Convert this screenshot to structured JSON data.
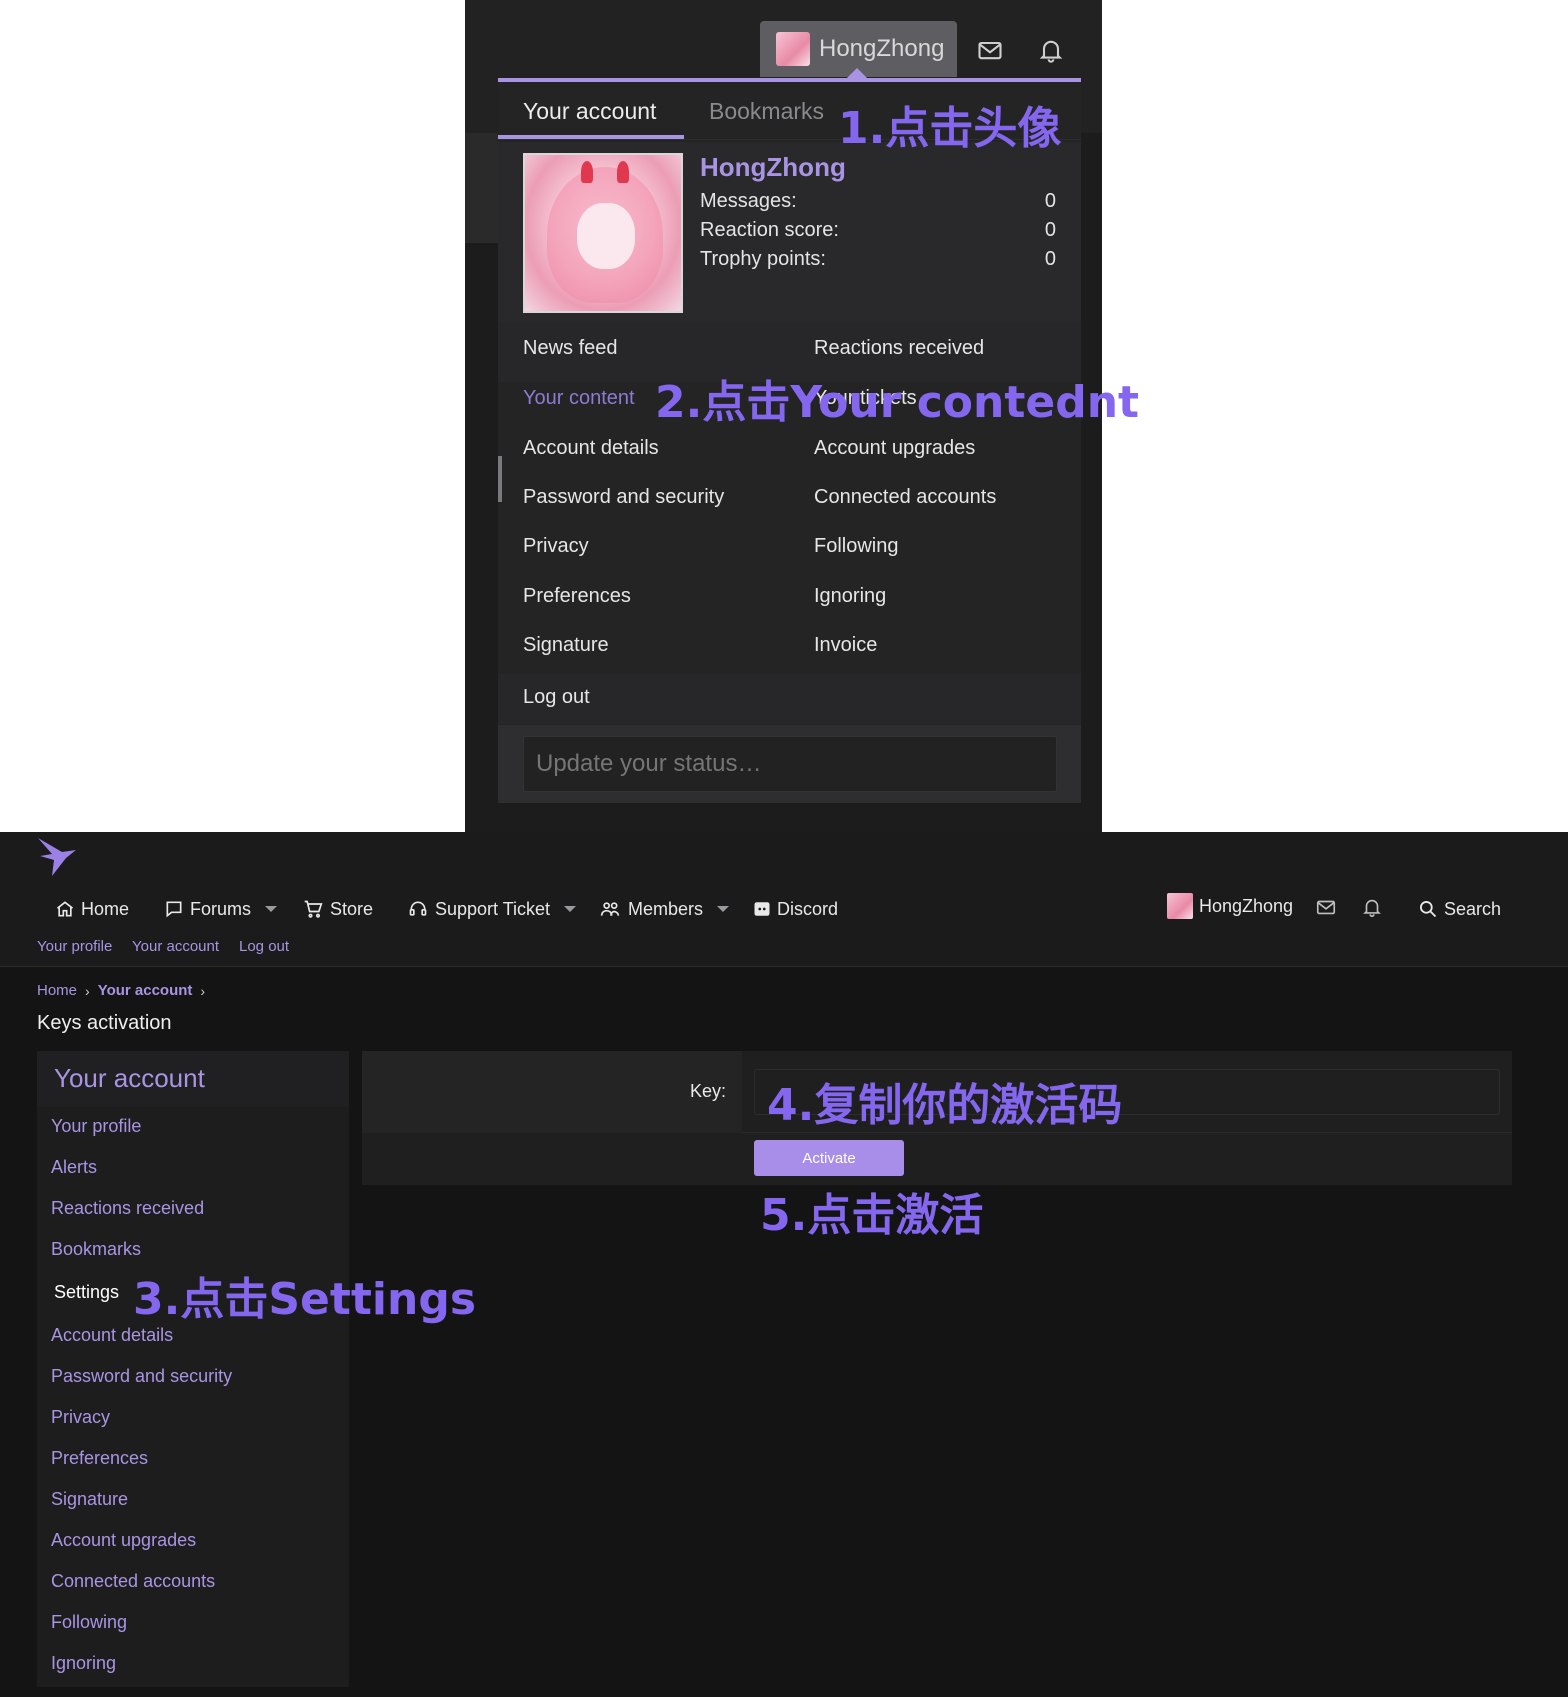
{
  "account_menu": {
    "username": "HongZhong",
    "tabs": {
      "your_account": "Your account",
      "bookmarks": "Bookmarks"
    },
    "profile": {
      "name": "HongZhong",
      "stats": [
        {
          "label": "Messages:",
          "value": "0"
        },
        {
          "label": "Reaction score:",
          "value": "0"
        },
        {
          "label": "Trophy points:",
          "value": "0"
        }
      ]
    },
    "items_left": [
      "News feed",
      "Your content",
      "Account details",
      "Password and security",
      "Privacy",
      "Preferences",
      "Signature",
      "Log out"
    ],
    "items_right": [
      "Reactions received",
      "Your tickets",
      "Account upgrades",
      "Connected accounts",
      "Following",
      "Ignoring",
      "Invoice"
    ],
    "status_placeholder": "Update your status…",
    "active_item": "Your content"
  },
  "header": {
    "nav": [
      {
        "label": "Home",
        "icon": "home-icon"
      },
      {
        "label": "Forums",
        "icon": "forum-icon",
        "dropdown": true
      },
      {
        "label": "Store",
        "icon": "cart-icon"
      },
      {
        "label": "Support Ticket",
        "icon": "support-icon",
        "dropdown": true
      },
      {
        "label": "Members",
        "icon": "members-icon",
        "dropdown": true
      },
      {
        "label": "Discord",
        "icon": "discord-icon"
      }
    ],
    "username": "HongZhong",
    "search_label": "Search",
    "sub_links": [
      "Your profile",
      "Your account",
      "Log out"
    ]
  },
  "breadcrumb": [
    "Home",
    "Your account"
  ],
  "page_title": "Keys activation",
  "sidebar": {
    "title": "Your account",
    "items": [
      "Your profile",
      "Alerts",
      "Reactions received",
      "Bookmarks",
      "Settings",
      "Account details",
      "Password and security",
      "Privacy",
      "Preferences",
      "Signature",
      "Account upgrades",
      "Connected accounts",
      "Following",
      "Ignoring"
    ],
    "current": "Settings"
  },
  "form": {
    "key_label": "Key:",
    "key_value": "",
    "activate_label": "Activate"
  },
  "annotations": {
    "step1": "1.点击头像",
    "step2": "2.点击Your contednt",
    "step3": "3.点击Settings",
    "step4": "4.复制你的激活码",
    "step5": "5.点击激活"
  },
  "colors": {
    "accent": "#a994e3",
    "annotation": "#8467ee",
    "button": "#a98ee9",
    "background": "#141415"
  }
}
